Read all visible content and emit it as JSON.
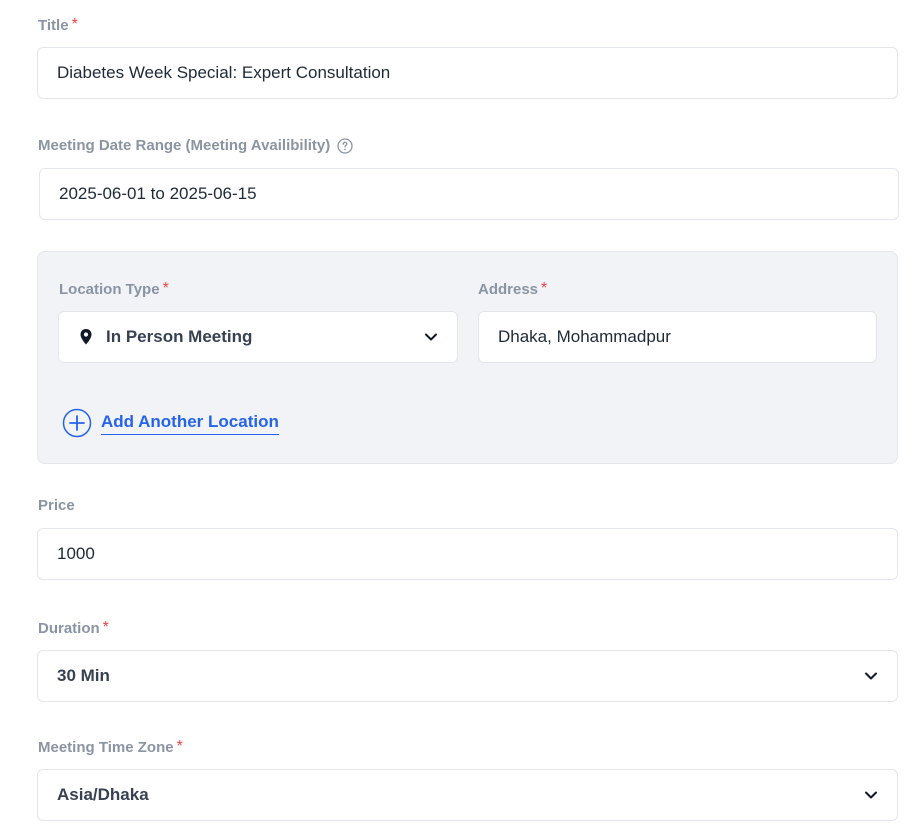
{
  "title_field": {
    "label": "Title",
    "required_mark": "*",
    "value": "Diabetes Week Special: Expert Consultation"
  },
  "date_range": {
    "label": "Meeting Date Range (Meeting Availibility)",
    "value": "2025-06-01 to 2025-06-15",
    "help_icon": "question-circle-icon"
  },
  "location": {
    "type_label": "Location Type",
    "type_value": "In Person Meeting",
    "type_icon": "map-pin-icon",
    "address_label": "Address",
    "address_value": "Dhaka, Mohammadpur",
    "required_mark": "*",
    "add_another": "Add Another Location",
    "accent": "#2563eb",
    "panel_bg": "#f1f3f6"
  },
  "price": {
    "label": "Price",
    "value": "1000"
  },
  "duration": {
    "label": "Duration",
    "required_mark": "*",
    "value": "30 Min"
  },
  "timezone": {
    "label": "Meeting Time Zone",
    "required_mark": "*",
    "value": "Asia/Dhaka"
  },
  "colors": {
    "label": "#8b94a3",
    "required": "#ef4444",
    "border": "#e3e6ea",
    "text": "#1f2937"
  }
}
